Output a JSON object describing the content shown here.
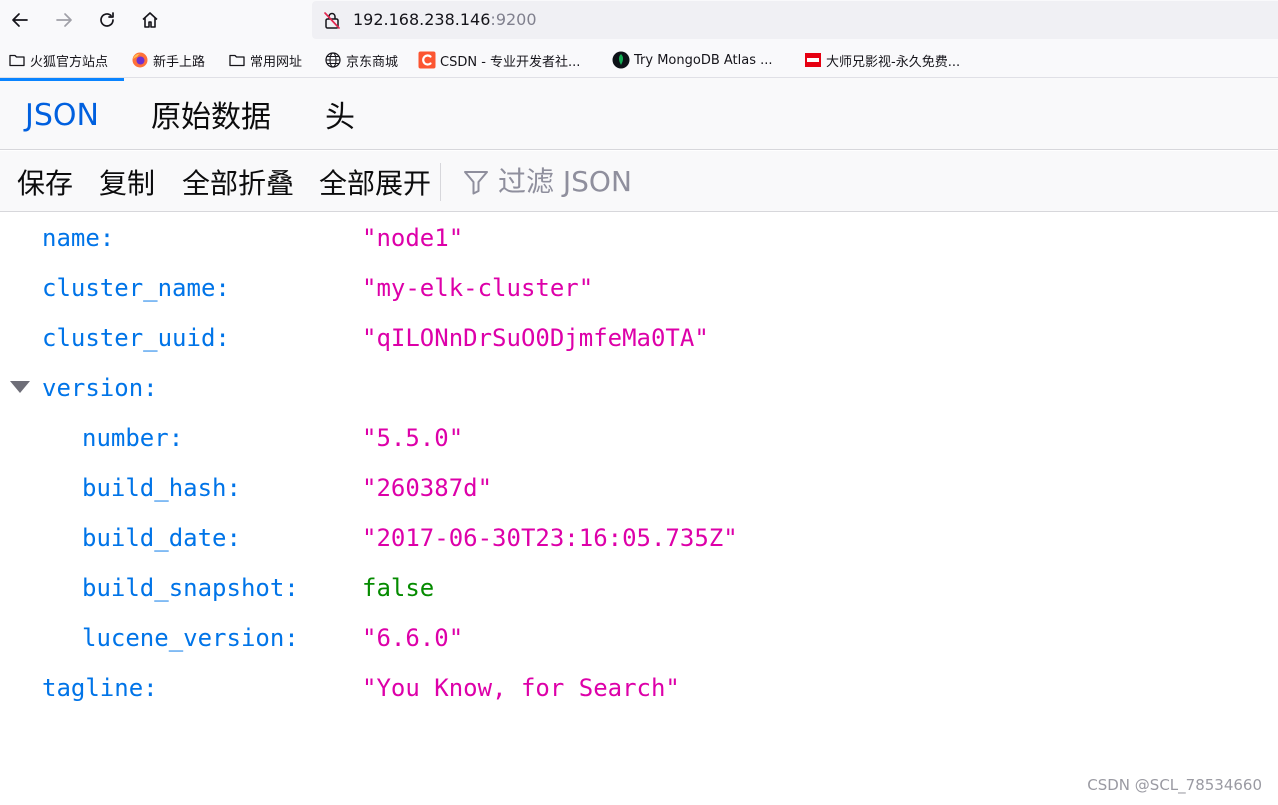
{
  "browser": {
    "url_host": "192.168.238.146",
    "url_port": ":9200",
    "bookmarks": [
      {
        "label": "火狐官方站点",
        "icon": "folder-icon"
      },
      {
        "label": "新手上路",
        "icon": "firefox-icon"
      },
      {
        "label": "常用网址",
        "icon": "folder-icon"
      },
      {
        "label": "京东商城",
        "icon": "globe-icon"
      },
      {
        "label": "CSDN - 专业开发者社...",
        "icon": "csdn-icon"
      },
      {
        "label": "Try MongoDB Atlas ...",
        "icon": "mongodb-leaf-icon"
      },
      {
        "label": "大师兄影视-永久免费...",
        "icon": "video-site-icon"
      }
    ]
  },
  "viewer": {
    "tabs": [
      {
        "label": "JSON",
        "active": true
      },
      {
        "label": "原始数据",
        "active": false
      },
      {
        "label": "头",
        "active": false
      }
    ],
    "toolbar": {
      "save": "保存",
      "copy": "复制",
      "collapse_all": "全部折叠",
      "expand_all": "全部展开",
      "filter_placeholder": "过滤 JSON"
    }
  },
  "json": {
    "name": {
      "key": "name:",
      "value": "\"node1\""
    },
    "cluster_name": {
      "key": "cluster_name:",
      "value": "\"my-elk-cluster\""
    },
    "cluster_uuid": {
      "key": "cluster_uuid:",
      "value": "\"qILONnDrSuO0DjmfeMa0TA\""
    },
    "version": {
      "key": "version:",
      "number": {
        "key": "number:",
        "value": "\"5.5.0\""
      },
      "build_hash": {
        "key": "build_hash:",
        "value": "\"260387d\""
      },
      "build_date": {
        "key": "build_date:",
        "value": "\"2017-06-30T23:16:05.735Z\""
      },
      "build_snapshot": {
        "key": "build_snapshot:",
        "value": "false"
      },
      "lucene_version": {
        "key": "lucene_version:",
        "value": "\"6.6.0\""
      }
    },
    "tagline": {
      "key": "tagline:",
      "value": "\"You Know, for Search\""
    }
  },
  "watermark": "CSDN @SCL_78534660",
  "colors": {
    "key": "#0074e8",
    "string": "#dd00a9",
    "boolean": "#058b00",
    "active_tab": "#0060df"
  }
}
